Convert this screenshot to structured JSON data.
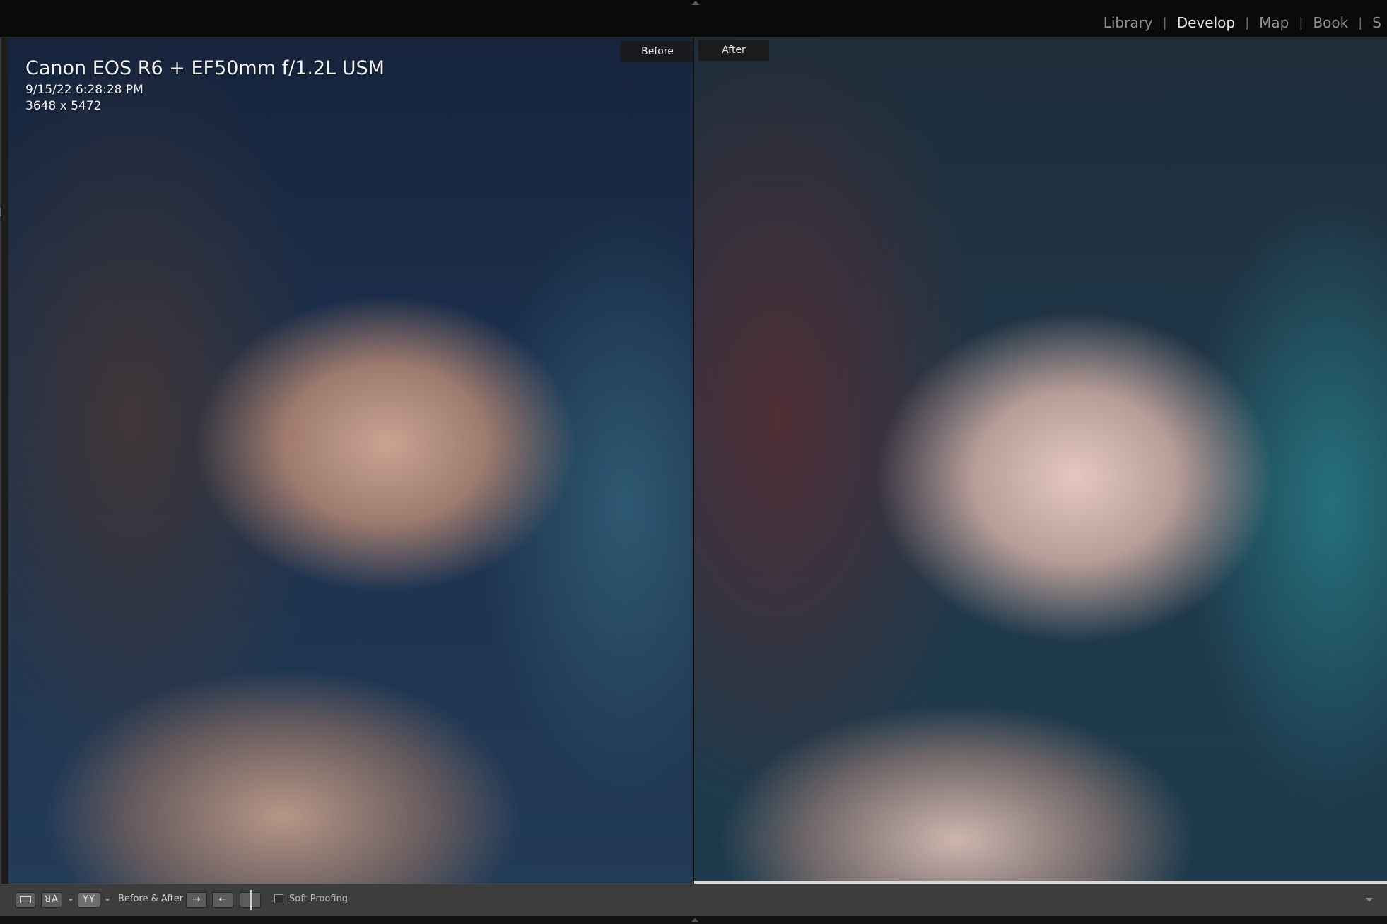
{
  "modules": {
    "items": [
      "Library",
      "Develop",
      "Map",
      "Book",
      "S"
    ],
    "active": "Develop"
  },
  "before_panel": {
    "tag": "Before"
  },
  "after_panel": {
    "tag": "After"
  },
  "info_overlay": {
    "camera": "Canon EOS R6 + EF50mm f/1.2L USM",
    "datetime": "9/15/22 6:28:28 PM",
    "dimensions": "3648 x 5472"
  },
  "toolbar": {
    "before_after_label": "Before & After :",
    "xy_glyph": "ꓤA",
    "yy_glyph": "YY",
    "soft_proofing_label": "Soft Proofing",
    "soft_proofing_checked": false
  }
}
